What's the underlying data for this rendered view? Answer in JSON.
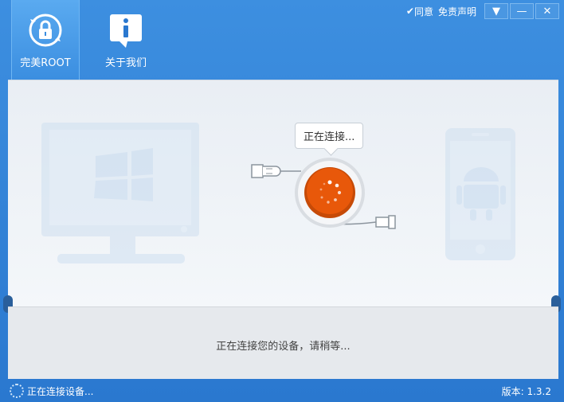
{
  "tabs": [
    {
      "label": "完美ROOT",
      "icon": "lock-refresh-icon"
    },
    {
      "label": "关于我们",
      "icon": "info-icon"
    }
  ],
  "topright": {
    "agree_label": "同意",
    "disclaimer_link": "免责声明"
  },
  "window_controls": {
    "menu": "▼",
    "minimize": "—",
    "close": "✕"
  },
  "connect_bubble": "正在连接...",
  "connect_message": "正在连接您的设备，请稍等...",
  "status": {
    "text": "正在连接设备...",
    "version": "版本: 1.3.2"
  },
  "colors": {
    "title_bar": "#3a8be0",
    "button_orange": "#e8580a",
    "panel_bg": "#eef2f6"
  }
}
